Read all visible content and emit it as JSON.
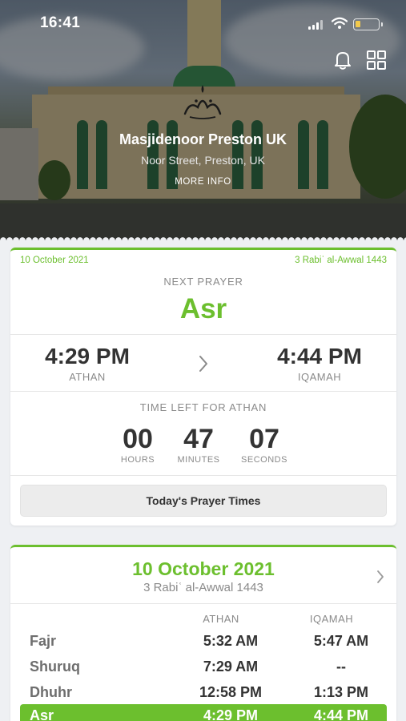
{
  "status_bar": {
    "time": "16:41"
  },
  "masjid": {
    "name": "Masjidenoor Preston UK",
    "address": "Noor Street, Preston, UK",
    "more_info": "MORE INFO"
  },
  "next_prayer_card": {
    "gregorian_date": "10 October 2021",
    "hijri_date": "3 Rabiʿ al-Awwal 1443",
    "next_prayer_label": "NEXT PRAYER",
    "next_prayer_name": "Asr",
    "athan_time": "4:29 PM",
    "athan_label": "ATHAN",
    "iqamah_time": "4:44 PM",
    "iqamah_label": "IQAMAH",
    "time_left_label": "TIME LEFT FOR ATHAN",
    "countdown": {
      "hours": "00",
      "hours_label": "HOURS",
      "minutes": "47",
      "minutes_label": "MINUTES",
      "seconds": "07",
      "seconds_label": "SECONDS"
    },
    "todays_button": "Today's Prayer Times"
  },
  "timetable_card": {
    "date": "10 October 2021",
    "hijri": "3 Rabiʿ al-Awwal 1443",
    "columns": {
      "athan": "ATHAN",
      "iqamah": "IQAMAH"
    },
    "rows": [
      {
        "name": "Fajr",
        "athan": "5:32 AM",
        "iqamah": "5:47 AM"
      },
      {
        "name": "Shuruq",
        "athan": "7:29 AM",
        "iqamah": "--"
      },
      {
        "name": "Dhuhr",
        "athan": "12:58 PM",
        "iqamah": "1:13 PM"
      },
      {
        "name": "Asr",
        "athan": "4:29 PM",
        "iqamah": "4:44 PM"
      }
    ],
    "active_row": "Asr"
  },
  "colors": {
    "accent": "#6cbf2e",
    "background": "#eef0f3"
  },
  "icons": [
    "bell-icon",
    "grid-icon",
    "chevron-right-icon",
    "masjid-logo"
  ]
}
